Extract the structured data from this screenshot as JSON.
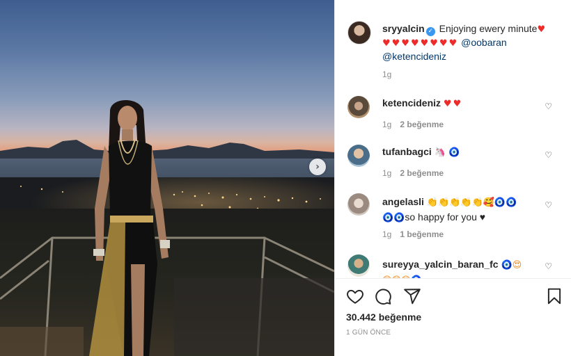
{
  "post": {
    "author": "sryyalcin",
    "caption_text": "Enjoying ewery minute",
    "caption_hearts_1": "♥",
    "caption_hearts_2": "♥♥♥♥♥♥♥♥",
    "mention_1": "@oobaran",
    "mention_2": "@ketencideniz",
    "caption_age": "1g",
    "likes": "30.442 beğenme",
    "date": "1 GÜN ÖNCE"
  },
  "comments": [
    {
      "user": "ketencideniz",
      "text": "",
      "emoji": "♥♥",
      "age": "1g",
      "likes": "2 beğenme",
      "avatar_icon": "avatar-dog"
    },
    {
      "user": "tufanbagci",
      "text": "",
      "emoji": "🦄 🧿",
      "age": "1g",
      "likes": "2 beğenme",
      "avatar_icon": "avatar-man"
    },
    {
      "user": "angelasli",
      "text": "so happy for you",
      "emoji_line1": "👏👏👏👏👏🥰🧿🧿",
      "emoji_line2": "🧿🧿",
      "emoji_end": "♥",
      "age": "1g",
      "likes": "1 beğenme",
      "avatar_icon": "avatar-woman"
    },
    {
      "user": "sureyya_yalcin_baran_fc",
      "text": "",
      "emoji": "🧿😍",
      "emoji_line2": "😍😍😍🧿",
      "avatar_icon": "avatar-woman-2"
    }
  ],
  "icons": {
    "heart": "heart-icon",
    "comment": "comment-icon",
    "share": "share-icon",
    "save": "bookmark-icon",
    "next": "chevron-right-icon"
  },
  "colors": {
    "heart_red": "#ed2b2b",
    "verified_blue": "#3897f0",
    "mention_blue": "#00376b",
    "muted": "#8e8e8e"
  }
}
